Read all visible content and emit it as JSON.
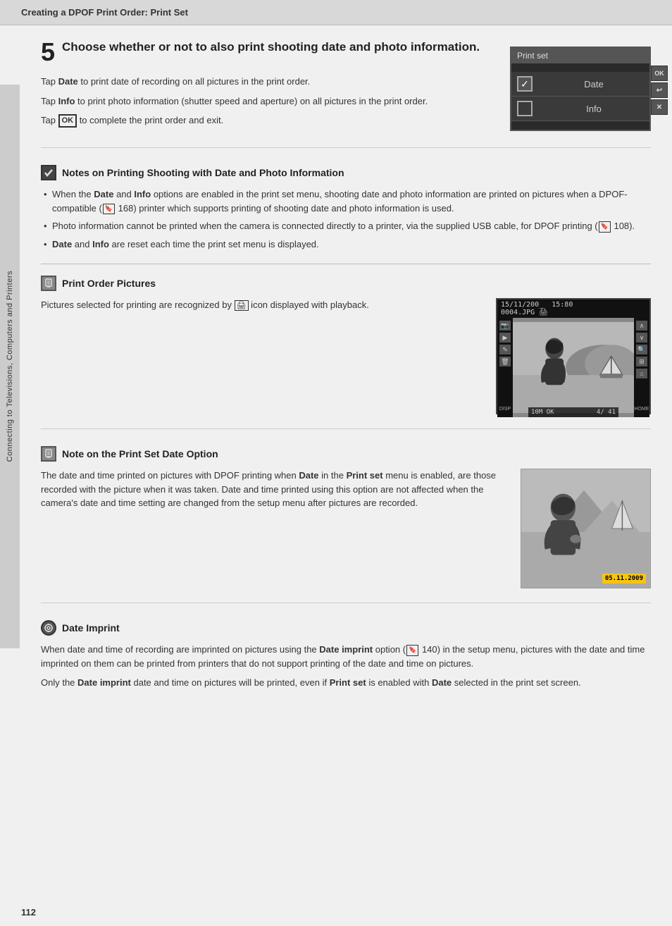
{
  "header": {
    "title": "Creating a DPOF Print Order: Print Set"
  },
  "side_tab": {
    "text": "Connecting to Televisions, Computers and Printers"
  },
  "step5": {
    "number": "5",
    "title": "Choose whether or not to also print shooting date and photo information.",
    "para1": "Tap Date to print date of recording on all pictures in the print order.",
    "para2": "Tap Info to print photo information (shutter speed and aperture) on all pictures in the print order.",
    "para3_prefix": "Tap ",
    "para3_ok": "OK",
    "para3_suffix": " to complete the print order and exit."
  },
  "camera_ui": {
    "title": "Print set",
    "row1_label": "Date",
    "row2_label": "Info",
    "btn1": "OK",
    "btn2": "↩",
    "btn3": "✕"
  },
  "notes_section": {
    "icon_type": "checkmark",
    "title": "Notes on Printing Shooting with Date and Photo Information",
    "bullets": [
      "When the Date and Info options are enabled in the print set menu, shooting date and photo information are printed on pictures when a DPOF-compatible (🔖 168) printer which supports printing of shooting date and photo information is used.",
      "Photo information cannot be printed when the camera is connected directly to a printer, via the supplied USB cable, for DPOF printing (🔖 108).",
      "Date and Info are reset each time the print set menu is displayed."
    ]
  },
  "print_order_section": {
    "icon_type": "pencil",
    "title": "Print Order Pictures",
    "body": "Pictures selected for printing are recognized by 🖨 icon displayed with playback.",
    "playback_header": "15/11/200_  15:80",
    "playback_header2": "0004.JPG 🖨",
    "playback_bottom": "10M  OK  4/  41",
    "disp_label": "DISP",
    "home_label": "HOME"
  },
  "date_option_section": {
    "icon_type": "pencil",
    "title": "Note on the Print Set Date Option",
    "body1": "The date and time printed on pictures with DPOF printing when ",
    "body1_bold": "Date",
    "body2": " in the ",
    "body2_bold": "Print set",
    "body3": " menu is enabled, are those recorded with the picture when it was taken. Date and time printed using this option are not affected when the camera's date and time setting are changed from the setup menu after pictures are recorded.",
    "date_stamp": "05.11.2009"
  },
  "date_imprint_section": {
    "icon_type": "camera-gear",
    "title": "Date Imprint",
    "body1": "When date and time of recording are imprinted on pictures using the ",
    "body1_bold": "Date imprint",
    "body2": " option (🔖 140) in the setup menu, pictures with the date and time imprinted on them can be printed from printers that do not support printing of the date and time on pictures.",
    "body3": "Only the ",
    "body3_bold": "Date imprint",
    "body4": " date and time on pictures will be printed, even if ",
    "body4_bold": "Print set",
    "body5": " is enabled with ",
    "body5_bold": "Date",
    "body6": " selected in the print set screen."
  },
  "page_number": "112"
}
